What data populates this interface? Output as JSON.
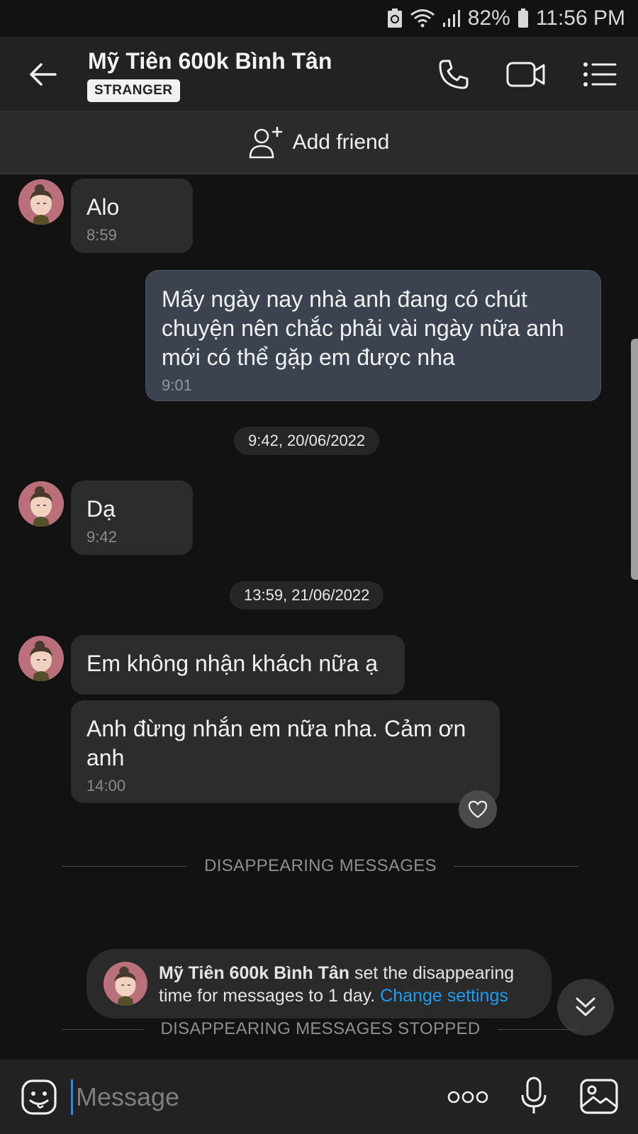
{
  "status_bar": {
    "battery": "82%",
    "time": "11:56 PM"
  },
  "header": {
    "contact_name": "Mỹ Tiên 600k Bình Tân",
    "badge": "STRANGER"
  },
  "add_friend": {
    "label": "Add friend"
  },
  "messages": [
    {
      "text": "Alo",
      "time": "8:59",
      "direction": "in"
    },
    {
      "text": "Mấy ngày nay nhà anh đang có chút chuyện nên chắc phải vài ngày nữa anh mới có thể gặp em được nha",
      "time": "9:01",
      "direction": "out"
    },
    {
      "date": "9:42, 20/06/2022"
    },
    {
      "text": "Dạ",
      "time": "9:42",
      "direction": "in"
    },
    {
      "date": "13:59, 21/06/2022"
    },
    {
      "text": "Em không nhận khách nữa ạ",
      "time": "",
      "direction": "in"
    },
    {
      "text": "Anh đừng nhắn em nữa nha. Cảm ơn anh",
      "time": "14:00",
      "direction": "in"
    }
  ],
  "separators": {
    "disappearing": "DISAPPEARING MESSAGES",
    "stopped": "DISAPPEARING MESSAGES STOPPED"
  },
  "system_message": {
    "name": "Mỹ Tiên 600k Bình Tân",
    "text": " set the disappearing time for messages to 1 day. ",
    "link": "Change settings",
    "link_color": "#1f9bf0"
  },
  "composer": {
    "placeholder": "Message"
  },
  "icons": {
    "back": "arrow-left-icon",
    "call": "phone-icon",
    "video": "video-camera-icon",
    "menu": "list-menu-icon",
    "add_friend": "add-user-icon",
    "heart": "heart-icon",
    "scroll_down": "double-chevron-down-icon",
    "sticker": "sticker-smile-icon",
    "more": "more-dots-icon",
    "mic": "microphone-icon",
    "image": "image-gallery-icon"
  },
  "colors": {
    "outgoing_bubble": "#3b4350",
    "incoming_bubble": "#2c2c2c",
    "accent": "#1f9bf0"
  }
}
